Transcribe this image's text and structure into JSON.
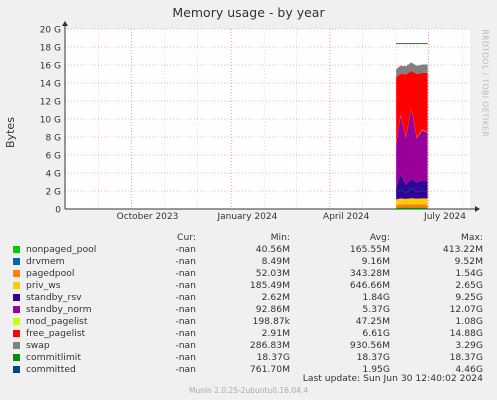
{
  "title": "Memory usage - by year",
  "watermark": "RRDTOOL / TOBI OETIKER",
  "ylabel": "Bytes",
  "legend_headers": {
    "cur": "Cur:",
    "min": "Min:",
    "avg": "Avg:",
    "max": "Max:"
  },
  "legend": [
    {
      "name": "nonpaged_pool",
      "color": "#00cc00",
      "cur": "-nan",
      "min": "40.56M",
      "avg": "165.55M",
      "max": "413.22M"
    },
    {
      "name": "drvmem",
      "color": "#0066b3",
      "cur": "-nan",
      "min": "8.49M",
      "avg": "9.16M",
      "max": "9.52M"
    },
    {
      "name": "pagedpool",
      "color": "#ff8000",
      "cur": "-nan",
      "min": "52.03M",
      "avg": "343.28M",
      "max": "1.54G"
    },
    {
      "name": "priv_ws",
      "color": "#ffcc00",
      "cur": "-nan",
      "min": "185.49M",
      "avg": "646.66M",
      "max": "2.65G"
    },
    {
      "name": "standby_rsv",
      "color": "#330099",
      "cur": "-nan",
      "min": "2.62M",
      "avg": "1.84G",
      "max": "9.25G"
    },
    {
      "name": "standby_norm",
      "color": "#990099",
      "cur": "-nan",
      "min": "92.86M",
      "avg": "5.37G",
      "max": "12.07G"
    },
    {
      "name": "mod_pagelist",
      "color": "#ccff00",
      "cur": "-nan",
      "min": "198.87k",
      "avg": "47.25M",
      "max": "1.08G"
    },
    {
      "name": "free_pagelist",
      "color": "#ff0000",
      "cur": "-nan",
      "min": "2.91M",
      "avg": "6.61G",
      "max": "14.88G"
    },
    {
      "name": "swap",
      "color": "#808080",
      "cur": "-nan",
      "min": "286.83M",
      "avg": "930.56M",
      "max": "3.29G"
    },
    {
      "name": "commitlimit",
      "color": "#008f00",
      "cur": "-nan",
      "min": "18.37G",
      "avg": "18.37G",
      "max": "18.37G"
    },
    {
      "name": "committed",
      "color": "#00487d",
      "cur": "-nan",
      "min": "761.70M",
      "avg": "1.95G",
      "max": "4.46G"
    }
  ],
  "last_update": "Last update:  Sun Jun 30 12:40:02 2024",
  "footer": "Munin 2.0.25-2ubuntu0.16.04.4",
  "chart_data": {
    "type": "area",
    "title": "Memory usage - by year",
    "ylabel": "Bytes",
    "ylim": [
      0,
      20
    ],
    "y_unit": "G",
    "yticks": [
      "0",
      "2 G",
      "4 G",
      "6 G",
      "8 G",
      "10 G",
      "12 G",
      "14 G",
      "16 G",
      "18 G",
      "20 G"
    ],
    "xticks": [
      "October 2023",
      "January 2024",
      "April 2024",
      "July 2024"
    ],
    "grid": true,
    "stacked": true,
    "x": [
      "2024-06-01",
      "2024-06-05",
      "2024-06-10",
      "2024-06-15",
      "2024-06-20",
      "2024-06-25",
      "2024-06-30"
    ],
    "series": [
      {
        "name": "nonpaged_pool",
        "values": [
          0.15,
          0.17,
          0.16,
          0.17,
          0.16,
          0.17,
          0.17
        ]
      },
      {
        "name": "drvmem",
        "values": [
          0.01,
          0.01,
          0.01,
          0.01,
          0.01,
          0.01,
          0.01
        ]
      },
      {
        "name": "pagedpool",
        "values": [
          0.3,
          0.35,
          0.33,
          0.35,
          0.34,
          0.35,
          0.34
        ]
      },
      {
        "name": "priv_ws",
        "values": [
          0.6,
          0.65,
          0.62,
          0.66,
          0.64,
          0.65,
          0.65
        ]
      },
      {
        "name": "standby_rsv",
        "values": [
          1.4,
          2.6,
          1.6,
          2.2,
          1.8,
          2.0,
          1.9
        ]
      },
      {
        "name": "standby_norm",
        "values": [
          4.8,
          6.6,
          5.2,
          7.8,
          4.9,
          5.6,
          5.4
        ]
      },
      {
        "name": "mod_pagelist",
        "values": [
          0.05,
          0.05,
          0.04,
          0.05,
          0.05,
          0.05,
          0.05
        ]
      },
      {
        "name": "free_pagelist",
        "values": [
          7.3,
          4.6,
          7.0,
          4.1,
          7.1,
          6.3,
          6.6
        ]
      },
      {
        "name": "swap",
        "values": [
          0.9,
          0.9,
          0.9,
          0.95,
          0.9,
          0.93,
          0.93
        ]
      },
      {
        "name": "commitlimit",
        "values": [
          18.37,
          18.37,
          18.37,
          18.37,
          18.37,
          18.37,
          18.37
        ]
      },
      {
        "name": "committed",
        "values": [
          1.9,
          2.1,
          1.8,
          2.3,
          1.9,
          2.0,
          1.95
        ]
      }
    ]
  }
}
